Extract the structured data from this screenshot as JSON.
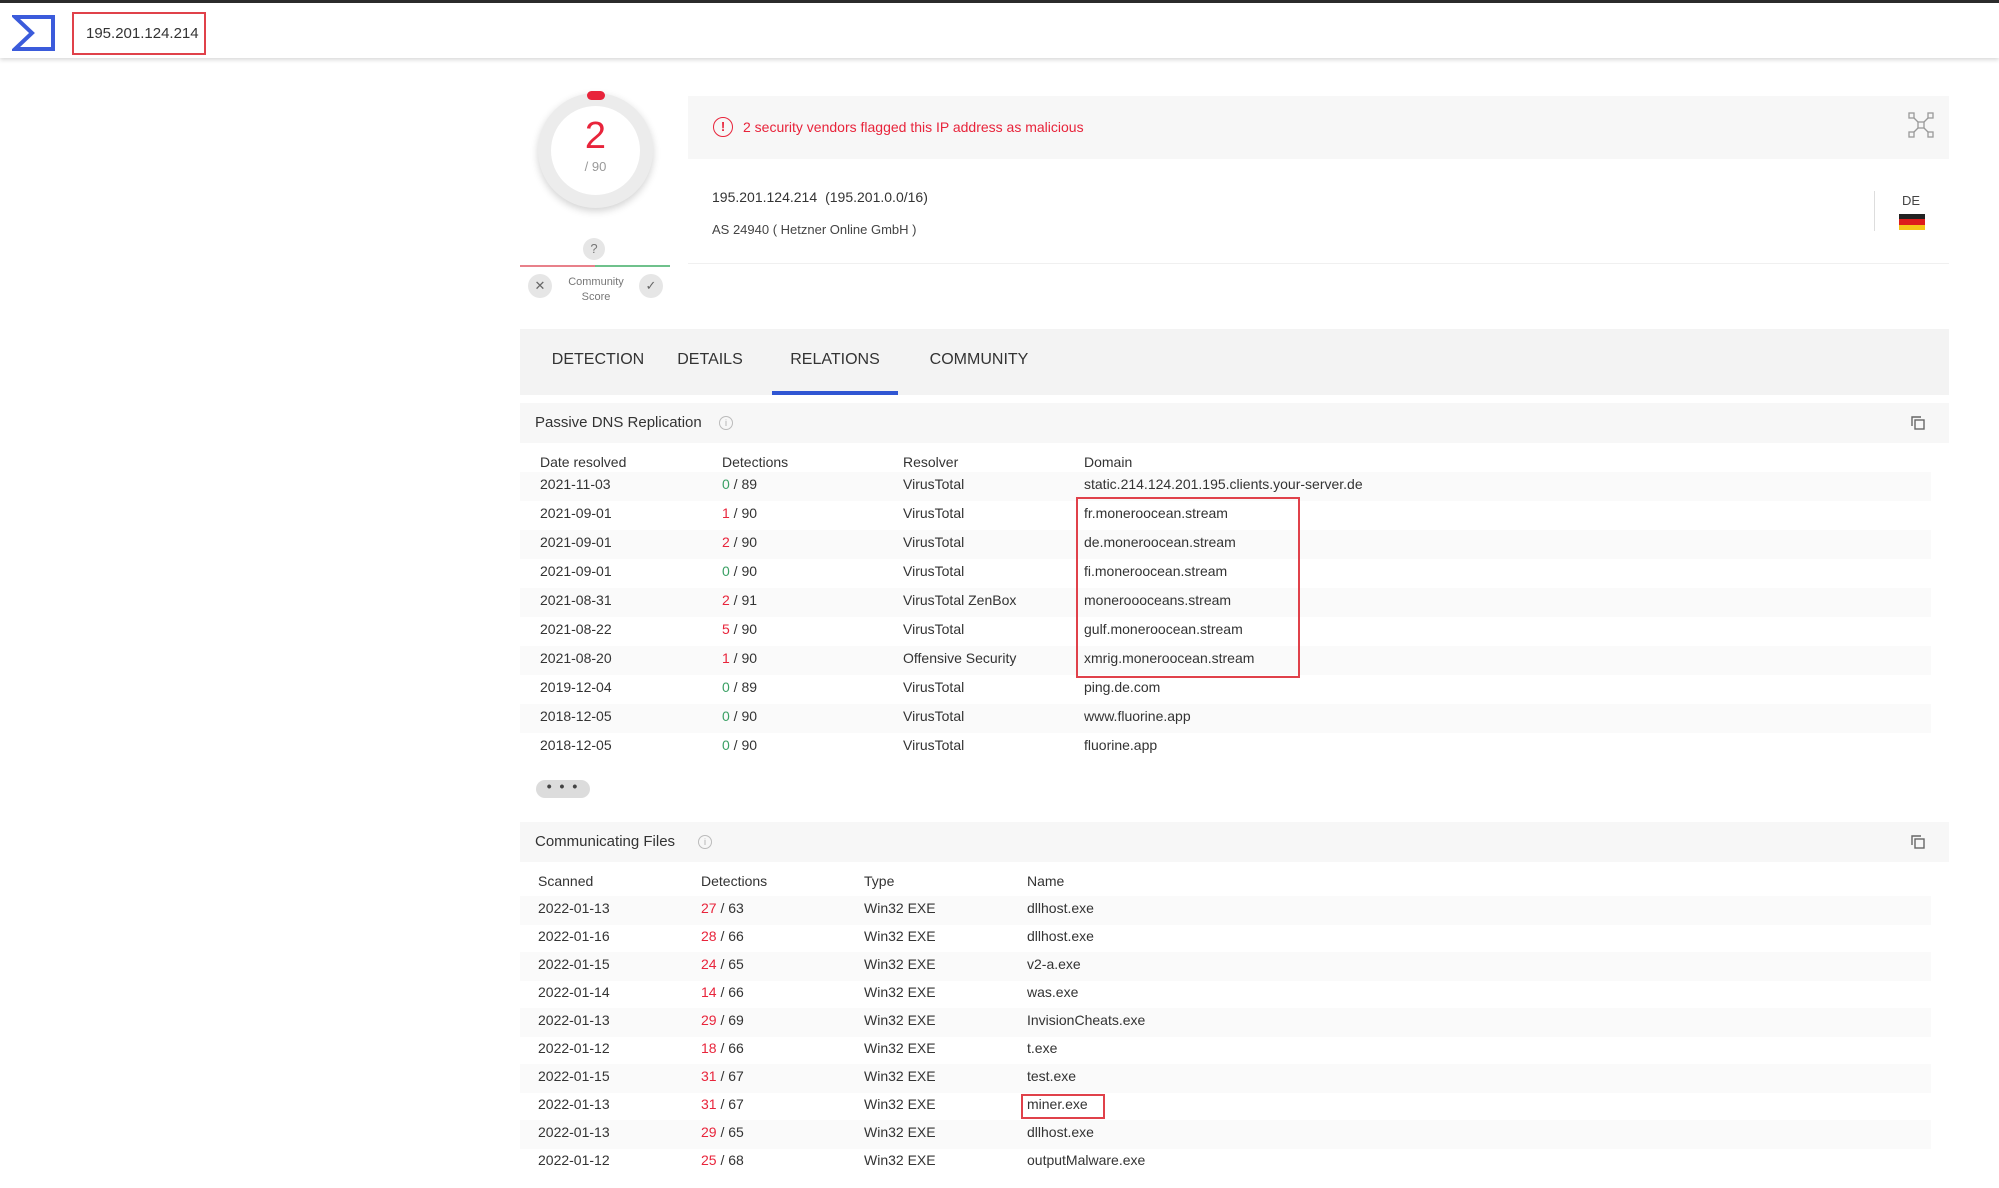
{
  "search": {
    "value": "195.201.124.214"
  },
  "score": {
    "detections": "2",
    "total": "/ 90"
  },
  "community": {
    "question": "?",
    "label": "Community Score",
    "down": "✕",
    "up": "✓"
  },
  "alert": {
    "text": "2 security vendors flagged this IP address as malicious",
    "icon": "!"
  },
  "ip_info": {
    "ip": "195.201.124.214",
    "range": "(195.201.0.0/16)",
    "asn": "AS 24940 ( Hetzner Online GmbH )",
    "country": "DE"
  },
  "tabs": [
    "DETECTION",
    "DETAILS",
    "RELATIONS",
    "COMMUNITY"
  ],
  "active_tab": "RELATIONS",
  "passive_dns": {
    "title": "Passive DNS Replication",
    "columns": [
      "Date resolved",
      "Detections",
      "Resolver",
      "Domain"
    ],
    "rows": [
      {
        "date": "2021-11-03",
        "pos": "0",
        "total": " / 89",
        "resolver": "VirusTotal",
        "domain": "static.214.124.201.195.clients.your-server.de"
      },
      {
        "date": "2021-09-01",
        "pos": "1",
        "total": " / 90",
        "resolver": "VirusTotal",
        "domain": "fr.moneroocean.stream"
      },
      {
        "date": "2021-09-01",
        "pos": "2",
        "total": " / 90",
        "resolver": "VirusTotal",
        "domain": "de.moneroocean.stream"
      },
      {
        "date": "2021-09-01",
        "pos": "0",
        "total": " / 90",
        "resolver": "VirusTotal",
        "domain": "fi.moneroocean.stream"
      },
      {
        "date": "2021-08-31",
        "pos": "2",
        "total": " / 91",
        "resolver": "VirusTotal ZenBox",
        "domain": "moneroooceans.stream"
      },
      {
        "date": "2021-08-22",
        "pos": "5",
        "total": " / 90",
        "resolver": "VirusTotal",
        "domain": "gulf.moneroocean.stream"
      },
      {
        "date": "2021-08-20",
        "pos": "1",
        "total": " / 90",
        "resolver": "Offensive Security",
        "domain": "xmrig.moneroocean.stream"
      },
      {
        "date": "2019-12-04",
        "pos": "0",
        "total": " / 89",
        "resolver": "VirusTotal",
        "domain": "ping.de.com"
      },
      {
        "date": "2018-12-05",
        "pos": "0",
        "total": " / 90",
        "resolver": "VirusTotal",
        "domain": "www.fluorine.app"
      },
      {
        "date": "2018-12-05",
        "pos": "0",
        "total": " / 90",
        "resolver": "VirusTotal",
        "domain": "fluorine.app"
      }
    ],
    "more": "• • •"
  },
  "communicating_files": {
    "title": "Communicating Files",
    "columns": [
      "Scanned",
      "Detections",
      "Type",
      "Name"
    ],
    "rows": [
      {
        "date": "2022-01-13",
        "pos": "27",
        "total": " / 63",
        "type": "Win32 EXE",
        "name": "dllhost.exe"
      },
      {
        "date": "2022-01-16",
        "pos": "28",
        "total": " / 66",
        "type": "Win32 EXE",
        "name": "dllhost.exe"
      },
      {
        "date": "2022-01-15",
        "pos": "24",
        "total": " / 65",
        "type": "Win32 EXE",
        "name": "v2-a.exe"
      },
      {
        "date": "2022-01-14",
        "pos": "14",
        "total": " / 66",
        "type": "Win32 EXE",
        "name": "was.exe"
      },
      {
        "date": "2022-01-13",
        "pos": "29",
        "total": " / 69",
        "type": "Win32 EXE",
        "name": "InvisionCheats.exe"
      },
      {
        "date": "2022-01-12",
        "pos": "18",
        "total": " / 66",
        "type": "Win32 EXE",
        "name": "t.exe"
      },
      {
        "date": "2022-01-15",
        "pos": "31",
        "total": " / 67",
        "type": "Win32 EXE",
        "name": "test.exe"
      },
      {
        "date": "2022-01-13",
        "pos": "31",
        "total": " / 67",
        "type": "Win32 EXE",
        "name": "miner.exe"
      },
      {
        "date": "2022-01-13",
        "pos": "29",
        "total": " / 65",
        "type": "Win32 EXE",
        "name": "dllhost.exe"
      },
      {
        "date": "2022-01-12",
        "pos": "25",
        "total": " / 68",
        "type": "Win32 EXE",
        "name": "outputMalware.exe"
      }
    ]
  },
  "colors": {
    "malicious": "#e8243b",
    "clean": "#3aa064",
    "accent": "#3056d3",
    "highlight": "#e0414a"
  }
}
